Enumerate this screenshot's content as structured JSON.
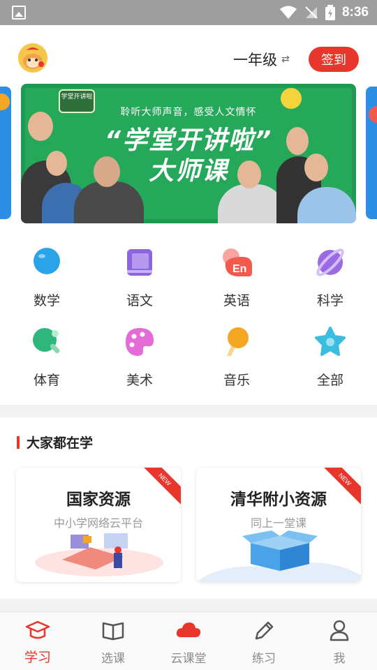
{
  "status_bar": {
    "time": "8:36"
  },
  "header": {
    "grade": "一年级",
    "switch_icon": "⇄",
    "signin": "签到"
  },
  "banner": {
    "logo": "学堂开讲啦",
    "subtitle": "聆听大师声音，感受人文情怀",
    "title_line1": "“学堂开讲啦”",
    "title_line2": "大师课"
  },
  "categories": [
    {
      "label": "数学",
      "icon": "balloon-icon",
      "color": "#2aa3e8"
    },
    {
      "label": "语文",
      "icon": "book-icon",
      "color": "#8b66dd"
    },
    {
      "label": "英语",
      "icon": "en-bubble-icon",
      "color": "#f25a4e"
    },
    {
      "label": "科学",
      "icon": "planet-icon",
      "color": "#9b6be6"
    },
    {
      "label": "体育",
      "icon": "pingpong-icon",
      "color": "#2fb67c"
    },
    {
      "label": "美术",
      "icon": "palette-icon",
      "color": "#e56bd6"
    },
    {
      "label": "音乐",
      "icon": "microphone-icon",
      "color": "#f5a623"
    },
    {
      "label": "全部",
      "icon": "star-icon",
      "color": "#3bbde0"
    }
  ],
  "section": {
    "title": "大家都在学",
    "cards": [
      {
        "title": "国家资源",
        "subtitle": "中小学网络云平台",
        "badge": "NEW"
      },
      {
        "title": "清华附小资源",
        "subtitle": "同上一堂课",
        "badge": "NEW"
      }
    ]
  },
  "nav": [
    {
      "label": "学习",
      "icon": "mortarboard-icon",
      "active": true
    },
    {
      "label": "选课",
      "icon": "open-book-icon"
    },
    {
      "label": "云课堂",
      "icon": "cloud-icon"
    },
    {
      "label": "练习",
      "icon": "pencil-icon"
    },
    {
      "label": "我",
      "icon": "person-icon"
    }
  ],
  "colors": {
    "accent": "#e8362c",
    "status_bar": "#9e9e9e"
  }
}
